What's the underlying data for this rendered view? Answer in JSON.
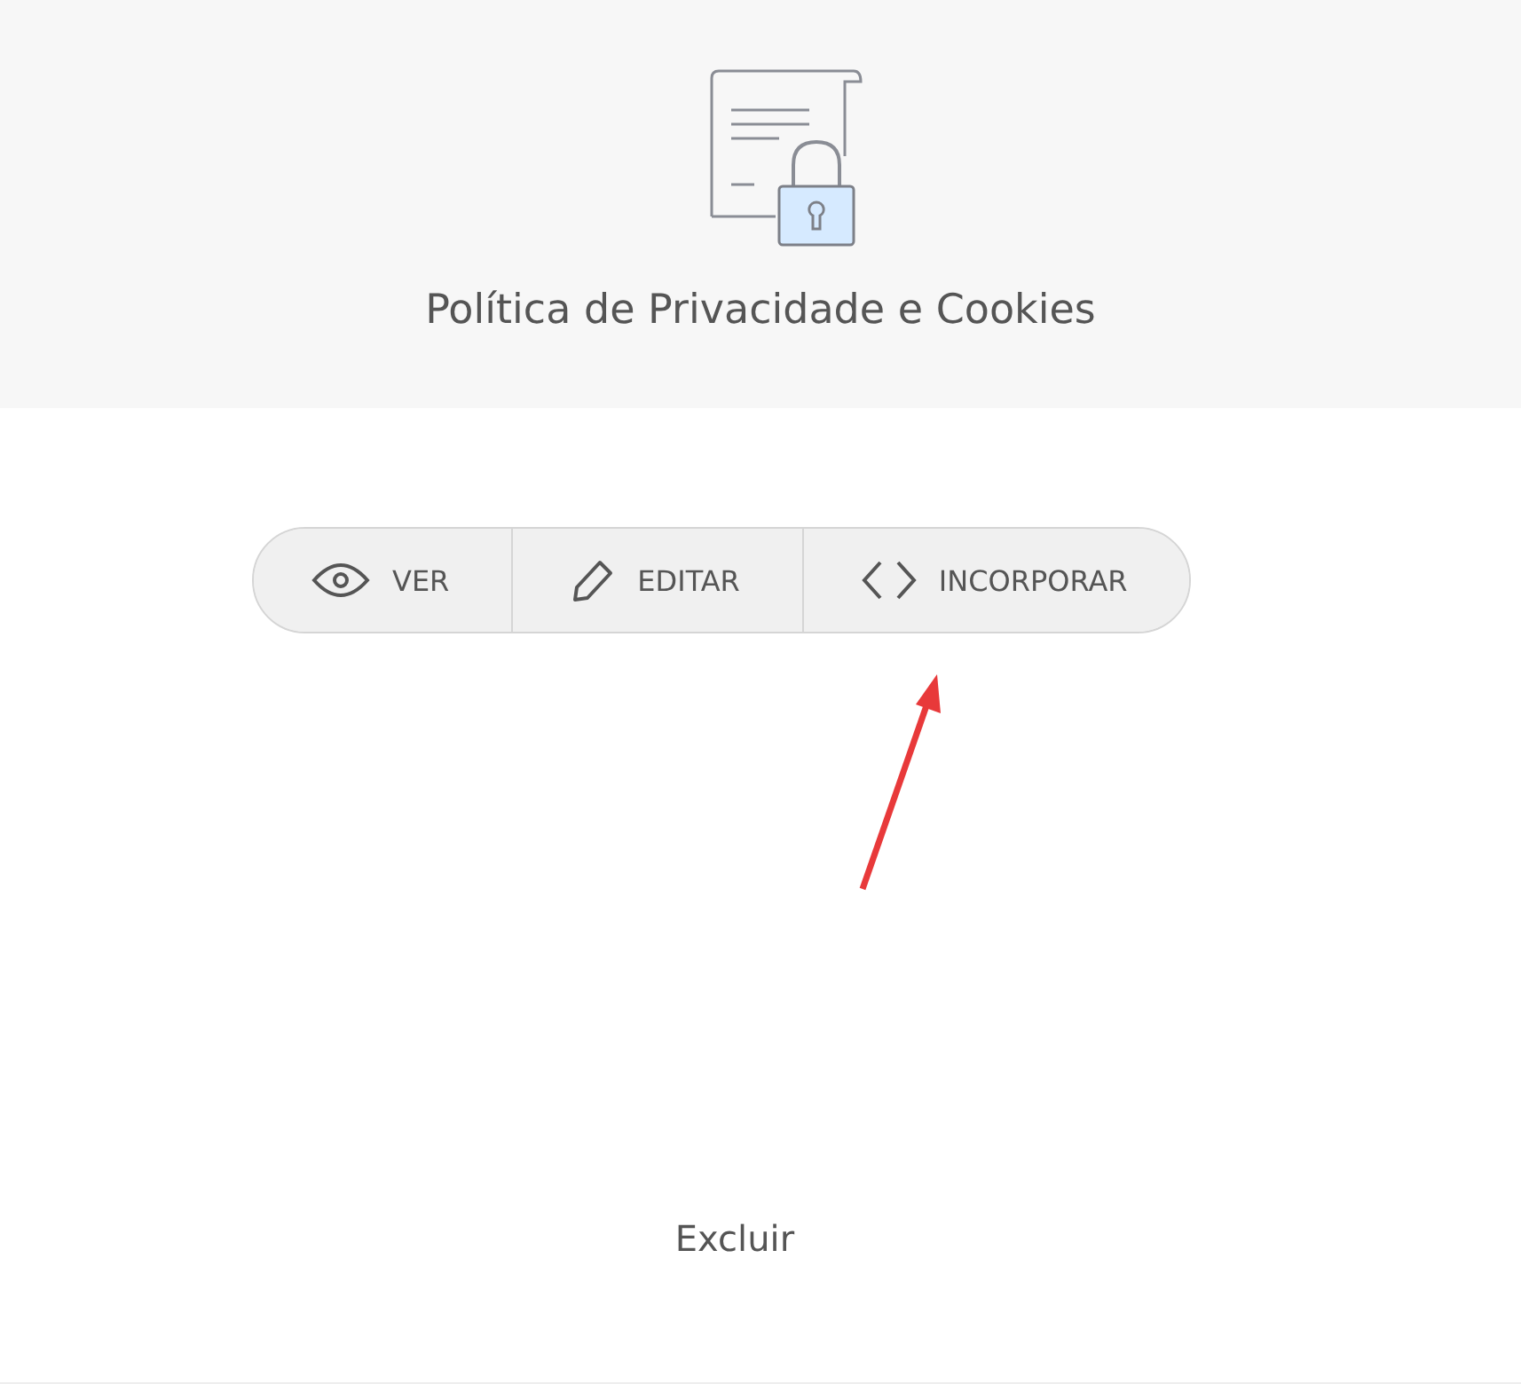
{
  "header": {
    "title": "Política de Privacidade e Cookies"
  },
  "actions": [
    {
      "kind": "view",
      "label": "VER"
    },
    {
      "kind": "edit",
      "label": "EDITAR"
    },
    {
      "kind": "embed",
      "label": "INCORPORAR"
    }
  ],
  "footer": {
    "link": "Excluir"
  }
}
